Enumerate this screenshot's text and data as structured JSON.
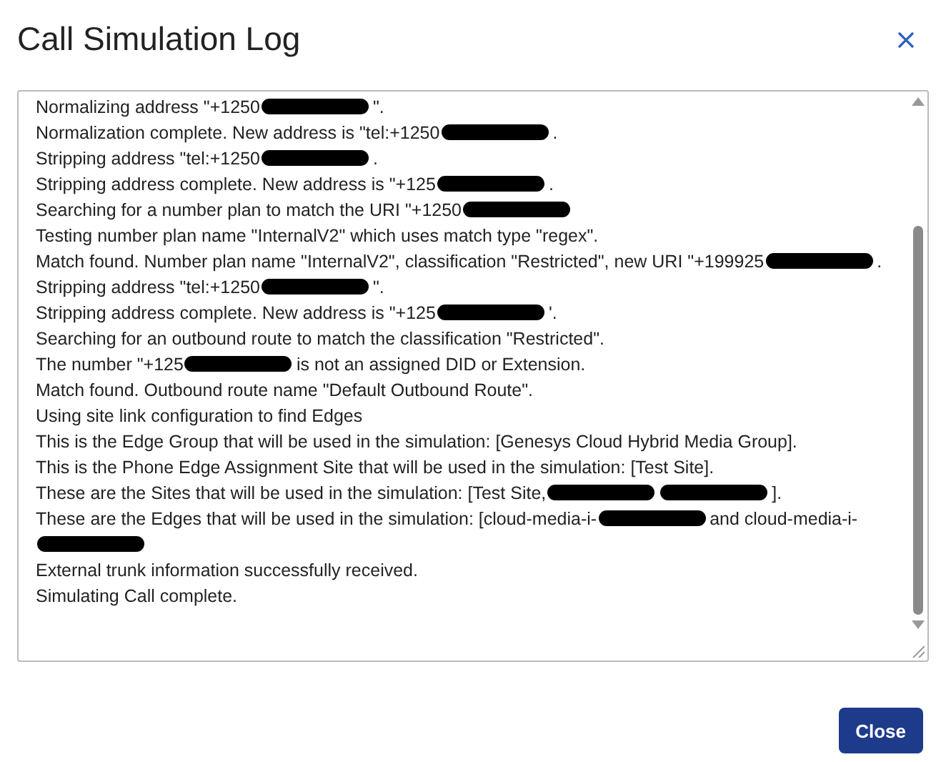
{
  "dialog": {
    "title": "Call Simulation Log"
  },
  "log": [
    {
      "parts": [
        {
          "kind": "text",
          "text": "Normalizing address \"+1250"
        },
        {
          "kind": "redaction"
        },
        {
          "kind": "text",
          "text": "\"."
        }
      ]
    },
    {
      "parts": [
        {
          "kind": "text",
          "text": "Normalization complete. New address is \"tel:+1250"
        },
        {
          "kind": "redaction"
        },
        {
          "kind": "text",
          "text": "."
        }
      ]
    },
    {
      "parts": [
        {
          "kind": "text",
          "text": "Stripping address \"tel:+1250"
        },
        {
          "kind": "redaction"
        },
        {
          "kind": "text",
          "text": "."
        }
      ]
    },
    {
      "parts": [
        {
          "kind": "text",
          "text": "Stripping address complete. New address is \"+125"
        },
        {
          "kind": "redaction"
        },
        {
          "kind": "text",
          "text": "."
        }
      ]
    },
    {
      "parts": [
        {
          "kind": "text",
          "text": "Searching for a number plan to match the URI \"+1250"
        },
        {
          "kind": "redaction"
        }
      ]
    },
    {
      "parts": [
        {
          "kind": "text",
          "text": "Testing number plan name \"InternalV2\" which uses match type \"regex\"."
        }
      ]
    },
    {
      "parts": [
        {
          "kind": "text",
          "text": "Match found. Number plan name \"InternalV2\", classification \"Restricted\", new URI \"+199925"
        },
        {
          "kind": "redaction"
        },
        {
          "kind": "text",
          "text": "."
        }
      ]
    },
    {
      "parts": [
        {
          "kind": "text",
          "text": "Stripping address \"tel:+1250"
        },
        {
          "kind": "redaction"
        },
        {
          "kind": "text",
          "text": "\"."
        }
      ]
    },
    {
      "parts": [
        {
          "kind": "text",
          "text": "Stripping address complete. New address is \"+125"
        },
        {
          "kind": "redaction"
        },
        {
          "kind": "text",
          "text": "'."
        }
      ]
    },
    {
      "parts": [
        {
          "kind": "text",
          "text": "Searching for an outbound route to match the classification \"Restricted\"."
        }
      ]
    },
    {
      "parts": [
        {
          "kind": "text",
          "text": "The number \"+125"
        },
        {
          "kind": "redaction"
        },
        {
          "kind": "text",
          "text": "is not an assigned DID or Extension."
        }
      ]
    },
    {
      "parts": [
        {
          "kind": "text",
          "text": "Match found. Outbound route name \"Default Outbound Route\"."
        }
      ]
    },
    {
      "parts": [
        {
          "kind": "text",
          "text": "Using site link configuration to find Edges"
        }
      ]
    },
    {
      "parts": [
        {
          "kind": "text",
          "text": "This is the Edge Group that will be used in the simulation: [Genesys Cloud Hybrid Media Group]."
        }
      ]
    },
    {
      "parts": [
        {
          "kind": "text",
          "text": "This is the Phone Edge Assignment Site that will be used in the simulation: [Test Site]."
        }
      ]
    },
    {
      "parts": [
        {
          "kind": "text",
          "text": "These are the Sites that will be used in the simulation: [Test Site,"
        },
        {
          "kind": "redaction"
        },
        {
          "kind": "redaction"
        },
        {
          "kind": "text",
          "text": "]."
        }
      ]
    },
    {
      "parts": [
        {
          "kind": "text",
          "text": "These are the Edges that will be used in the simulation: [cloud-media-i-"
        },
        {
          "kind": "redaction"
        },
        {
          "kind": "text",
          "text": "and cloud-media-i-"
        },
        {
          "kind": "redaction"
        }
      ]
    },
    {
      "parts": [
        {
          "kind": "text",
          "text": "External trunk information successfully received."
        }
      ]
    },
    {
      "parts": [
        {
          "kind": "text",
          "text": "Simulating Call complete."
        }
      ]
    }
  ],
  "buttons": [
    {
      "label": "Close"
    }
  ]
}
